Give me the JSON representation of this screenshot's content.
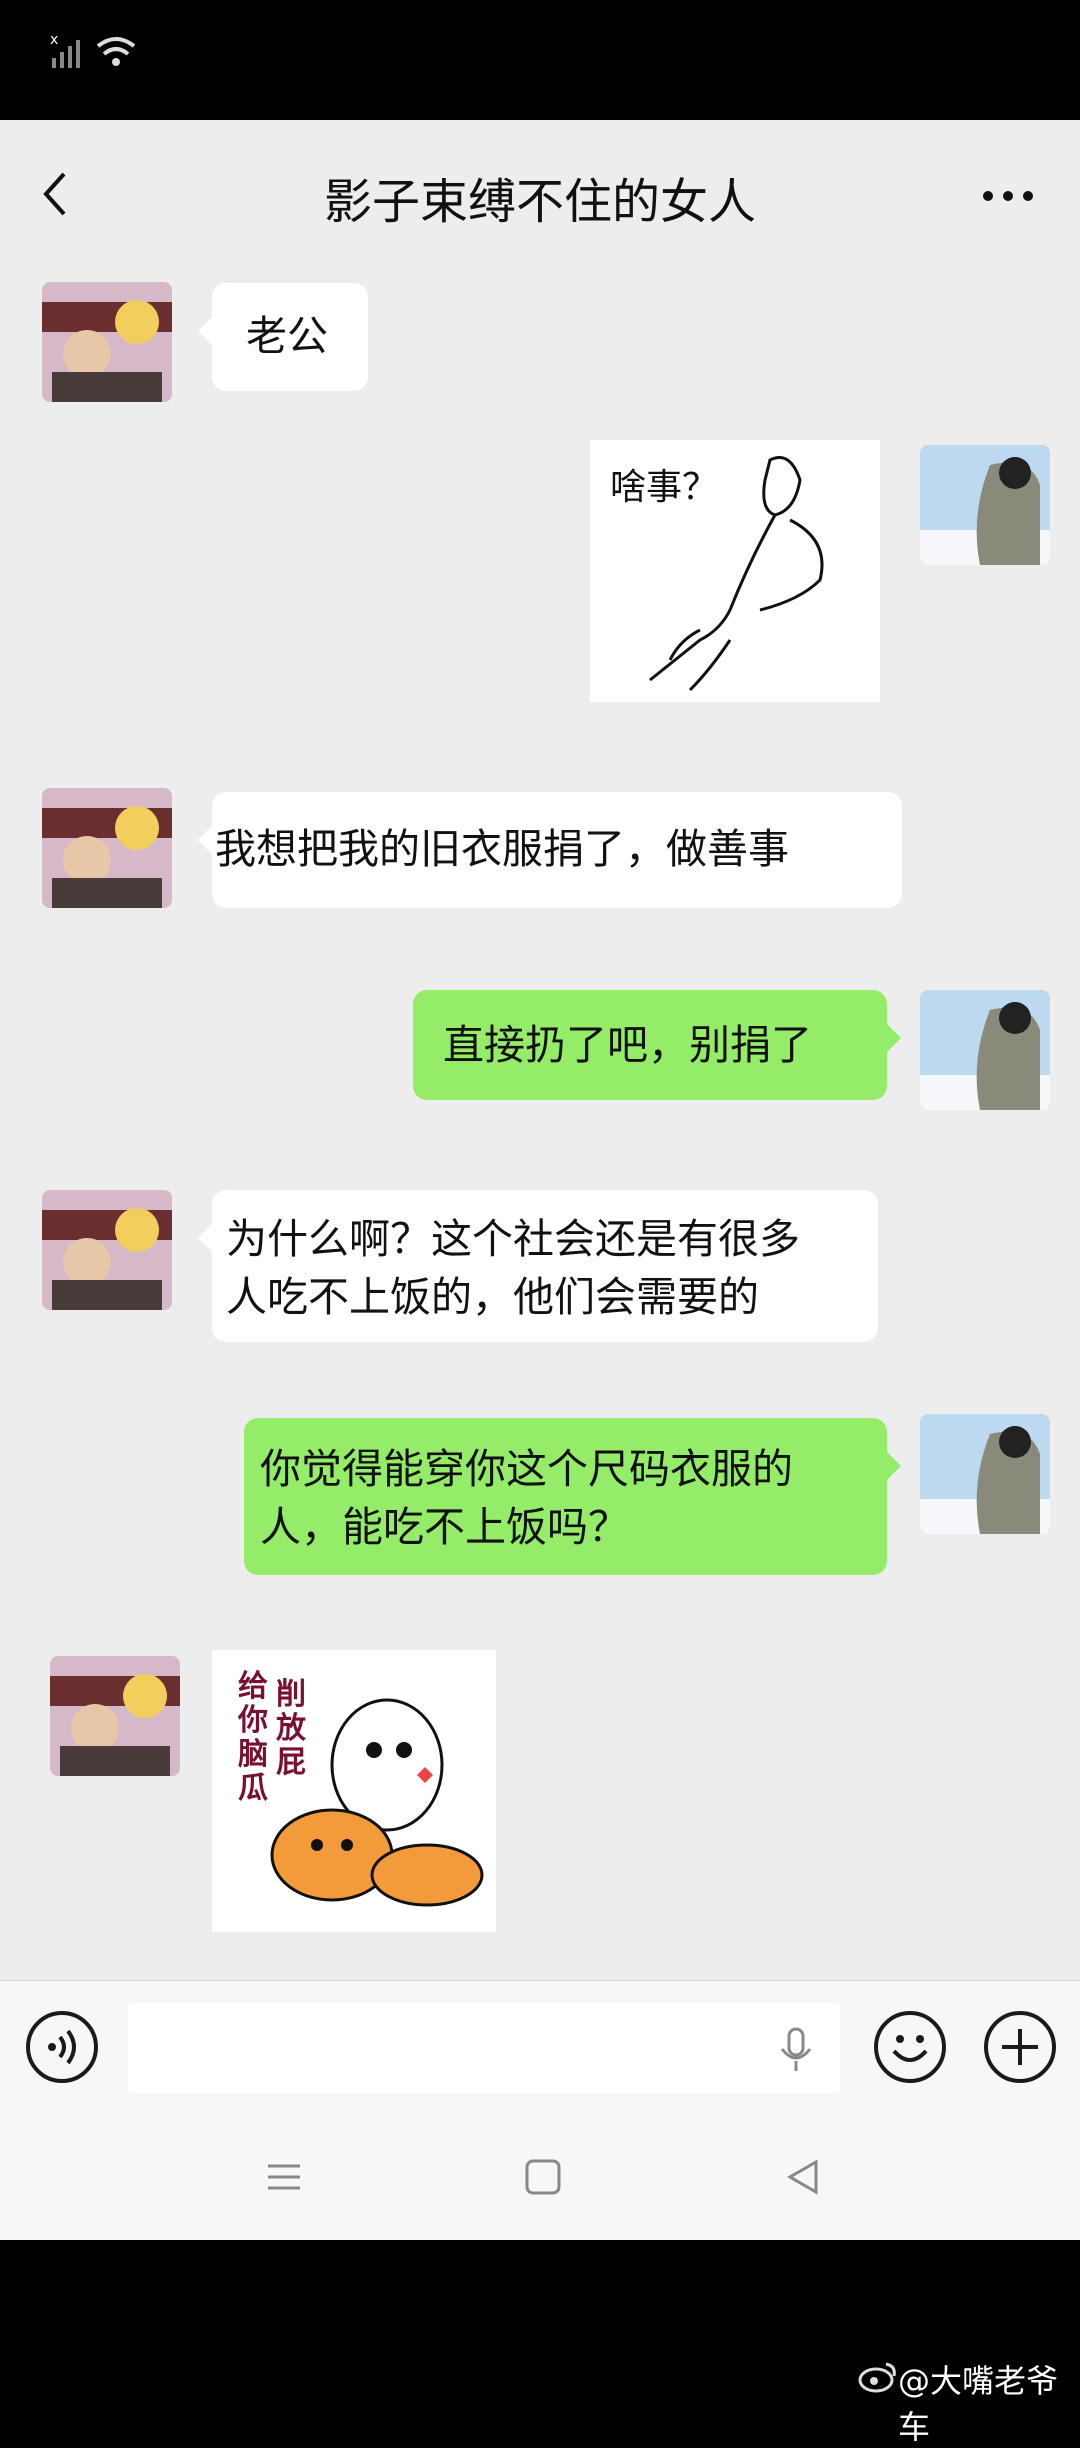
{
  "status_bar": {
    "signal_icon": "signal-icon",
    "wifi_icon": "wifi-icon",
    "right_text": "",
    "right_text_note_color": "#444"
  },
  "header": {
    "back_icon": "chevron-left-icon",
    "title": "影子束缚不住的女人",
    "more_icon": "more-icon"
  },
  "messages": [
    {
      "side": "left",
      "type": "text",
      "text": "老公"
    },
    {
      "side": "right",
      "type": "sticker",
      "sticker_text": "啥事？"
    },
    {
      "side": "left",
      "type": "text",
      "text": "我想把我的旧衣服捐了，做善事"
    },
    {
      "side": "right",
      "type": "text",
      "text": "直接扔了吧，别捐了"
    },
    {
      "side": "left",
      "type": "text",
      "line1": "为什么啊？这个社会还是有很多",
      "line2": "人吃不上饭的，他们会需要的"
    },
    {
      "side": "right",
      "type": "text",
      "line1": "你觉得能穿你这个尺码衣服的",
      "line2": "人，能吃不上饭吗？"
    },
    {
      "side": "left",
      "type": "sticker",
      "sticker_text_a": "给你脑瓜",
      "sticker_text_b": "削放屁"
    }
  ],
  "input_bar": {
    "voice_icon": "voice-icon",
    "mic_icon": "mic-icon",
    "emoji_icon": "emoji-icon",
    "plus_icon": "plus-icon",
    "input_value": ""
  },
  "nav_bar": {
    "menu_icon": "menu-icon",
    "home_icon": "home-square-icon",
    "back_icon": "back-triangle-icon"
  },
  "watermark": {
    "icon": "weibo-icon",
    "text": "@大嘴老爷车"
  },
  "colors": {
    "chat_bg": "#ededed",
    "green_bubble": "#95ec69",
    "white_bubble": "#ffffff"
  }
}
